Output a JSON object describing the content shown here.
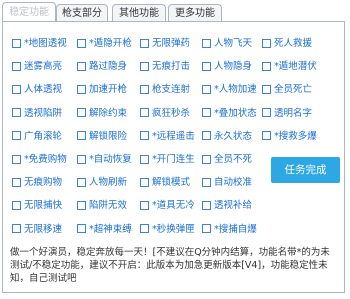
{
  "tabs": [
    "稳定功能",
    "枪支部分",
    "其他功能",
    "更多功能"
  ],
  "features": [
    [
      "*地图透视",
      "*遁隐开枪",
      "无限弹药",
      "人物飞天",
      "死人救援"
    ],
    [
      "迷雾高亮",
      "路过隐身",
      "无痕打击",
      "人物隐身",
      "*遁地潜伏"
    ],
    [
      "人体透视",
      "加速开枪",
      "枪支连射",
      "*人物加速",
      "全员死亡"
    ],
    [
      "透视陷阱",
      "解除约束",
      "疯狂秒杀",
      "*叠加状态",
      "透明名字"
    ],
    [
      "广角滚轮",
      "解锁限险",
      "*远程遥击",
      "永久状态",
      "*搜救多爆"
    ],
    [
      "*免费购物",
      "*自动恢复",
      "*开门连生",
      "全员不死",
      ""
    ],
    [
      "无痕购物",
      "人物刷新",
      "解锁模式",
      "自动校准",
      ""
    ],
    [
      "无限捕快",
      "陷阱无效",
      "*道具无冷",
      "透视补给",
      ""
    ],
    [
      "无限移速",
      "*超神束缚",
      "*秒换弹匣",
      "*搜捕自爆",
      ""
    ]
  ],
  "complete_button": "任务完成",
  "notice": "做一个好演员，稳定奔放每一天！[不建议在Q分钟内结算，功能名带*的为未测试/不稳定功能，建议不开启：此版本为加急更新版本[V4]，功能稳定性未知，自己测试吧"
}
